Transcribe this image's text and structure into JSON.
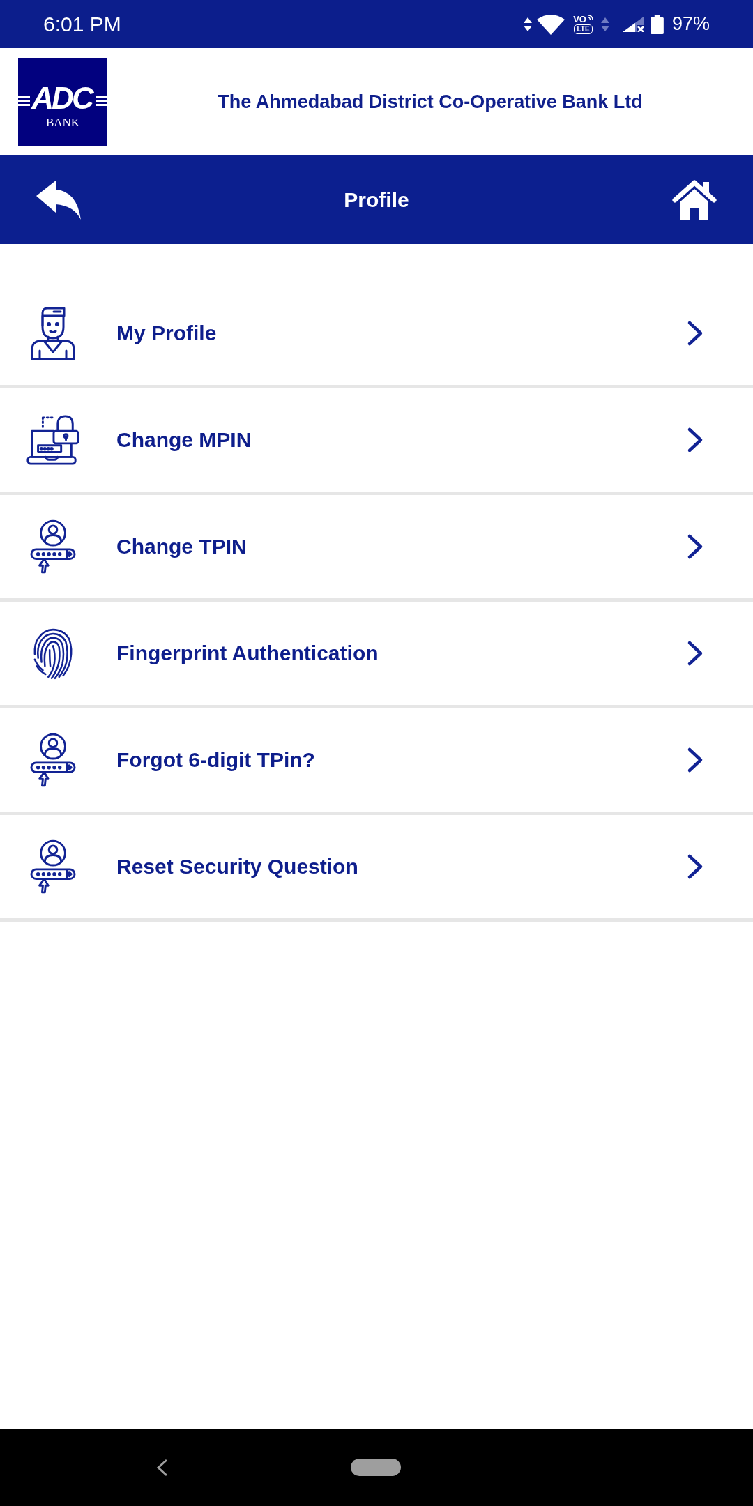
{
  "status_bar": {
    "time": "6:01 PM",
    "volte": {
      "top": "VO",
      "bottom": "LTE"
    },
    "battery": "97%"
  },
  "header": {
    "logo": {
      "letters": "ADC",
      "caption": "BANK"
    },
    "title": "The Ahmedabad District Co-Operative Bank Ltd"
  },
  "nav_bar": {
    "title": "Profile"
  },
  "menu": {
    "items": [
      {
        "label": "My Profile",
        "kind": "person"
      },
      {
        "label": "Change MPIN",
        "kind": "laptop"
      },
      {
        "label": "Change TPIN",
        "kind": "userpin"
      },
      {
        "label": "Fingerprint Authentication",
        "kind": "fingerprint"
      },
      {
        "label": "Forgot 6-digit TPin?",
        "kind": "userpin"
      },
      {
        "label": "Reset Security Question",
        "kind": "userpin"
      }
    ]
  }
}
